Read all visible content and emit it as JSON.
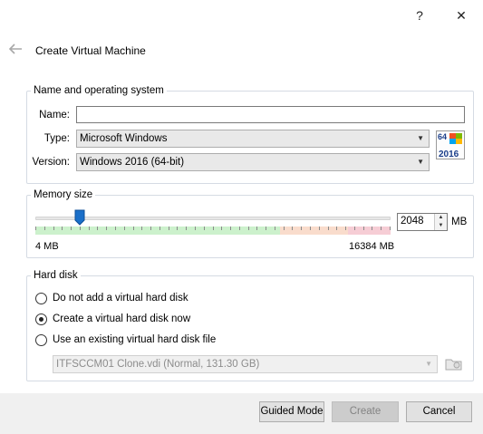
{
  "window": {
    "help_label": "?",
    "close_label": "✕"
  },
  "dialog": {
    "title": "Create Virtual Machine"
  },
  "name_os": {
    "group_title": "Name and operating system",
    "name_label": "Name:",
    "name_value": "",
    "type_label": "Type:",
    "type_value": "Microsoft Windows",
    "version_label": "Version:",
    "version_value": "Windows 2016 (64-bit)",
    "os_icon": "windows-2016-64-icon",
    "os_icon_text_top": "64",
    "os_icon_text_bottom": "2016"
  },
  "memory": {
    "group_title": "Memory size",
    "value": "2048",
    "unit": "MB",
    "min_label": "4 MB",
    "max_label": "16384 MB",
    "slider_fraction": 0.125
  },
  "hard_disk": {
    "group_title": "Hard disk",
    "options": [
      {
        "label": "Do not add a virtual hard disk",
        "checked": false
      },
      {
        "label": "Create a virtual hard disk now",
        "checked": true
      },
      {
        "label": "Use an existing virtual hard disk file",
        "checked": false
      }
    ],
    "existing_file": "ITFSCCM01 Clone.vdi (Normal, 131.30 GB)",
    "folder_icon": "choose-disk-folder-icon"
  },
  "footer": {
    "guided_label": "Guided Mode",
    "create_label": "Create",
    "cancel_label": "Cancel"
  },
  "colors": {
    "slider_thumb": "#1a6fc9",
    "scale_green": "#ccf1cc",
    "scale_orange": "#f9dccc",
    "scale_red": "#f6cdd5"
  }
}
